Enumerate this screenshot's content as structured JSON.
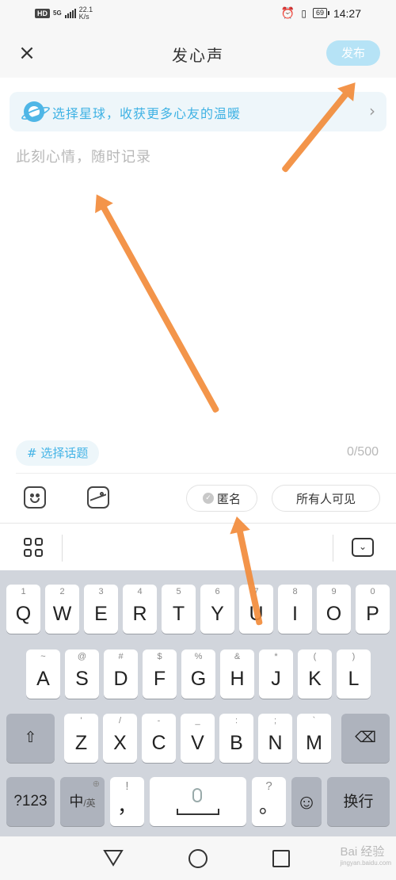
{
  "status_bar": {
    "hd": "HD",
    "network": "5G",
    "speed_value": "22.1",
    "speed_unit": "K/s",
    "battery": "69",
    "time": "14:27"
  },
  "header": {
    "close_icon": "×",
    "title": "发心声",
    "publish_label": "发布"
  },
  "planet_bar": {
    "text": "选择星球，收获更多心友的温暖",
    "chevron": "›"
  },
  "editor": {
    "placeholder": "此刻心情，随时记录",
    "value": ""
  },
  "topic_button": "# 选择话题",
  "char_count": "0/500",
  "tools": {
    "anonymous_label": "匿名",
    "visibility_label": "所有人可见"
  },
  "keyboard": {
    "row1": [
      {
        "hint": "1",
        "key": "Q"
      },
      {
        "hint": "2",
        "key": "W"
      },
      {
        "hint": "3",
        "key": "E"
      },
      {
        "hint": "4",
        "key": "R"
      },
      {
        "hint": "5",
        "key": "T"
      },
      {
        "hint": "6",
        "key": "Y"
      },
      {
        "hint": "7",
        "key": "U"
      },
      {
        "hint": "8",
        "key": "I"
      },
      {
        "hint": "9",
        "key": "O"
      },
      {
        "hint": "0",
        "key": "P"
      }
    ],
    "row2": [
      {
        "hint": "~",
        "key": "A"
      },
      {
        "hint": "@",
        "key": "S"
      },
      {
        "hint": "#",
        "key": "D"
      },
      {
        "hint": "$",
        "key": "F"
      },
      {
        "hint": "%",
        "key": "G"
      },
      {
        "hint": "&",
        "key": "H"
      },
      {
        "hint": "*",
        "key": "J"
      },
      {
        "hint": "(",
        "key": "K"
      },
      {
        "hint": ")",
        "key": "L"
      }
    ],
    "row3": [
      {
        "hint": "'",
        "key": "Z"
      },
      {
        "hint": "/",
        "key": "X"
      },
      {
        "hint": "-",
        "key": "C"
      },
      {
        "hint": "_",
        "key": "V"
      },
      {
        "hint": ":",
        "key": "B"
      },
      {
        "hint": ";",
        "key": "N"
      },
      {
        "hint": "`",
        "key": "M"
      }
    ],
    "shift": "⇧",
    "backspace": "⌫",
    "num_key": "?123",
    "lang_key_main": "中",
    "lang_key_sub": "/英",
    "comma_hint": "!",
    "comma_key": "，",
    "period_hint": "?",
    "period_key": "。",
    "emoji_key": "☺",
    "enter_key": "换行"
  },
  "watermark": {
    "text": "Bai 经验",
    "sub": "jingyan.baidu.com"
  },
  "colors": {
    "accent": "#45b4e6",
    "publish_bg": "#b6e3f6",
    "annotation_arrow": "#f28c3b"
  }
}
